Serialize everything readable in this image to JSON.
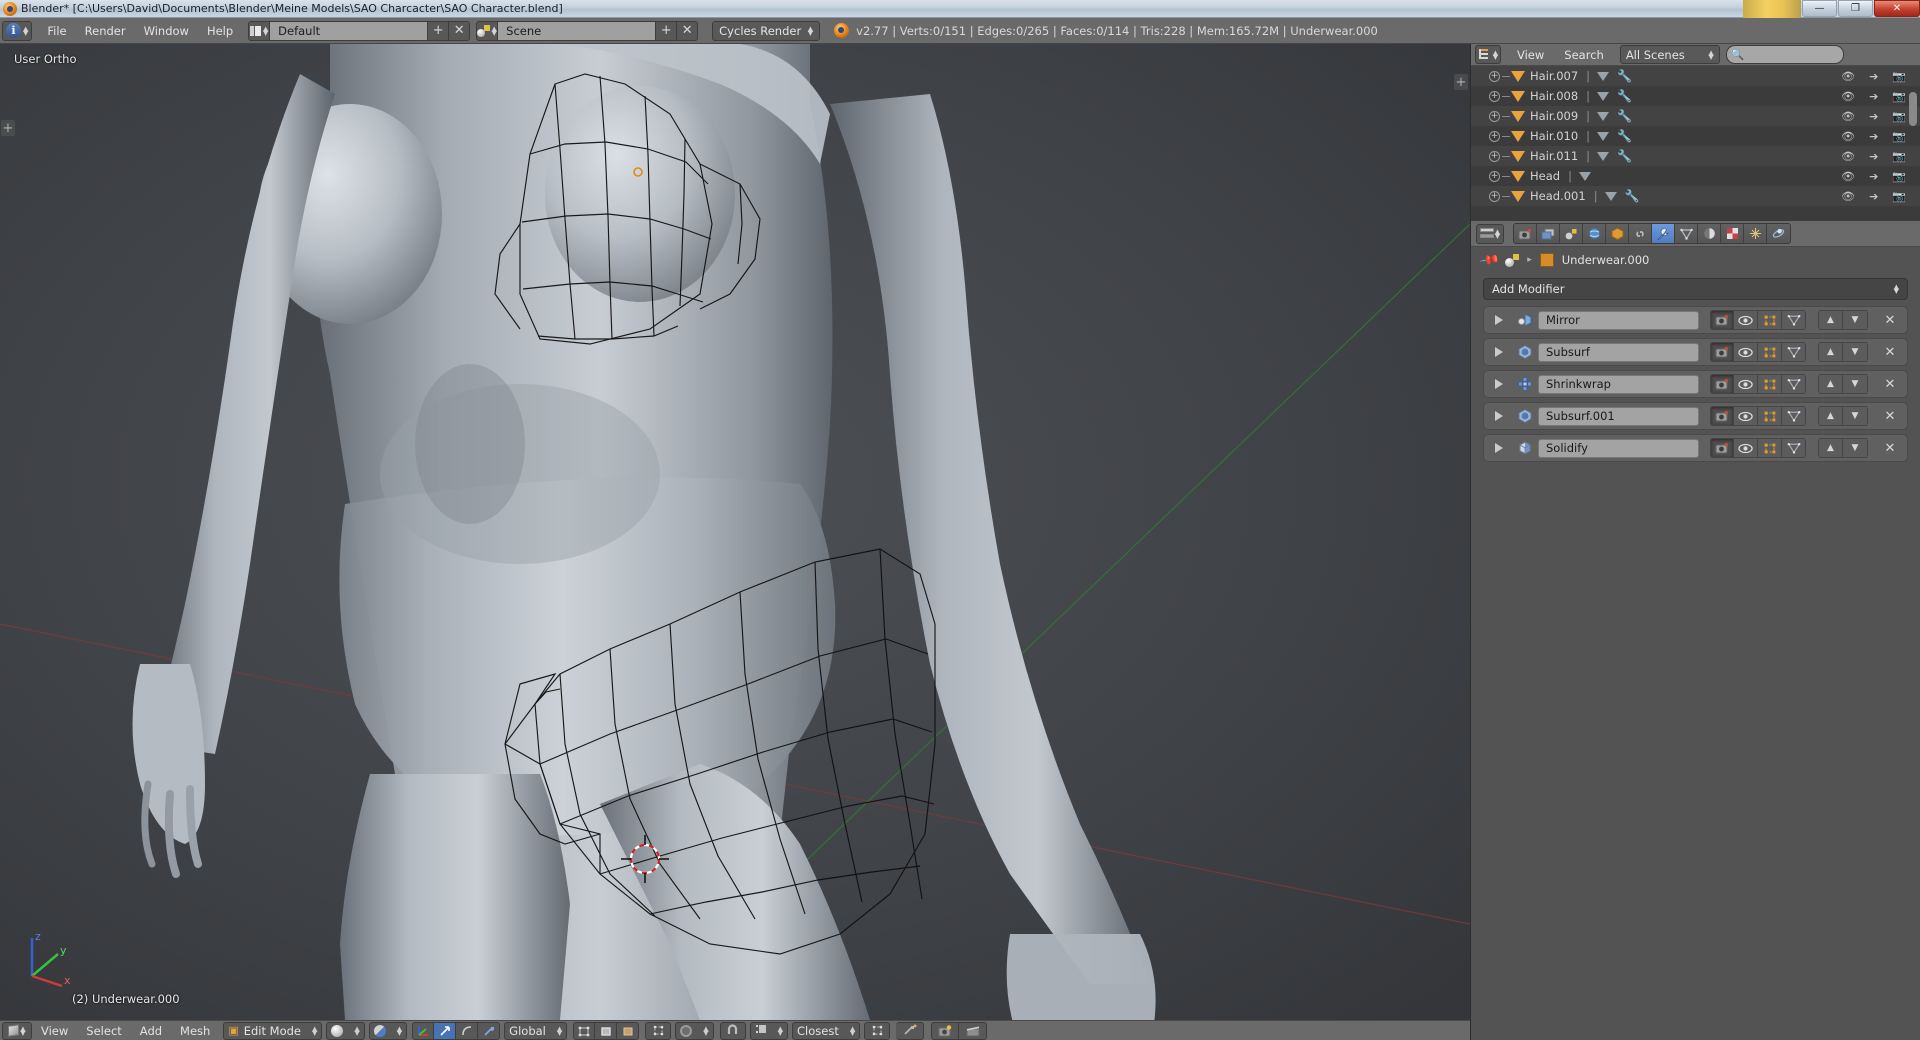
{
  "window": {
    "title": "Blender* [C:\\Users\\David\\Documents\\Blender\\Meine Models\\SAO Charcacter\\SAO Character.blend]",
    "minimize": "—",
    "restore": "❐",
    "close": "✕"
  },
  "topbar": {
    "editor_icon": "info-editor-icon",
    "menus": [
      "File",
      "Render",
      "Window",
      "Help"
    ],
    "screen_layout": "Default",
    "screen_add": "+",
    "screen_delete": "✕",
    "scene_name": "Scene",
    "scene_add": "+",
    "scene_delete": "✕",
    "render_engine": "Cycles Render",
    "stats": "v2.77 | Verts:0/151 | Edges:0/265 | Faces:0/114 | Tris:228 | Mem:165.72M | Underwear.000",
    "stats_parts": {
      "version": "v2.77",
      "verts": "Verts:0/151",
      "edges": "Edges:0/265",
      "faces": "Faces:0/114",
      "tris": "Tris:228",
      "mem": "Mem:165.72M",
      "object": "Underwear.000"
    }
  },
  "viewport": {
    "view_name": "User Ortho",
    "object_label": "(2) Underwear.000",
    "axis_labels": {
      "x": "x",
      "y": "y",
      "z": "z"
    },
    "axis_colors": {
      "x": "#d33a3a",
      "y": "#36c23a",
      "z": "#3a5fd3"
    },
    "plus_left": "+",
    "plus_right": "+",
    "background_color": "#44474b"
  },
  "viewport_footer": {
    "editor_icon": "3d-view-editor-icon",
    "menus": [
      "View",
      "Select",
      "Add",
      "Mesh"
    ],
    "mode": "Edit Mode",
    "viewport_shading": "solid-shading-icon",
    "shading_extra": "material-mode-icon",
    "manipulator_icons": [
      "translate-manipulator-icon",
      "rotate-manipulator-icon",
      "scale-manipulator-icon"
    ],
    "transform_orientation": "Global",
    "select_modes": [
      "vertex-select-icon",
      "edge-select-icon",
      "face-select-icon"
    ],
    "limit_selection": "limit-selection-visible-icon",
    "proportional_edit": "proportional-edit-icon",
    "snap_magnet": "snap-magnet-icon",
    "snap_element": "snap-element-icon",
    "snap_target": "Closest",
    "snap_extra": "snap-onto-self-icon",
    "pivot": "pivot-point-icon",
    "render_buttons": [
      "render-image-icon",
      "render-animation-icon"
    ]
  },
  "outliner": {
    "editor_icon": "outliner-editor-icon",
    "menus": [
      "View",
      "Search"
    ],
    "display_mode": "All Scenes",
    "search_placeholder": "",
    "search_icon": "search-icon",
    "rows": [
      {
        "name": "Hair.007",
        "has_modifier": true
      },
      {
        "name": "Hair.008",
        "has_modifier": true
      },
      {
        "name": "Hair.009",
        "has_modifier": true
      },
      {
        "name": "Hair.010",
        "has_modifier": true
      },
      {
        "name": "Hair.011",
        "has_modifier": true
      },
      {
        "name": "Head",
        "has_modifier": false
      },
      {
        "name": "Head.001",
        "has_modifier": true
      }
    ],
    "row_icons": {
      "eye": "visibility-eye-icon",
      "arrow": "selectable-arrow-icon",
      "camera": "renderable-camera-icon"
    }
  },
  "properties": {
    "editor_icon": "properties-editor-icon",
    "tabs": [
      {
        "name": "render-tab",
        "icon": "camera-back-icon",
        "active": false
      },
      {
        "name": "render-layers-tab",
        "icon": "images-icon",
        "active": false
      },
      {
        "name": "scene-tab",
        "icon": "scene-icon",
        "active": false
      },
      {
        "name": "world-tab",
        "icon": "world-globe-icon",
        "active": false
      },
      {
        "name": "object-tab",
        "icon": "object-cube-icon",
        "active": false
      },
      {
        "name": "constraints-tab",
        "icon": "chain-link-icon",
        "active": false
      },
      {
        "name": "modifiers-tab",
        "icon": "wrench-icon",
        "active": true
      },
      {
        "name": "data-tab",
        "icon": "mesh-data-triangle-icon",
        "active": false
      },
      {
        "name": "material-tab",
        "icon": "material-sphere-icon",
        "active": false
      },
      {
        "name": "texture-tab",
        "icon": "texture-checker-icon",
        "active": false
      },
      {
        "name": "particles-tab",
        "icon": "particles-icon",
        "active": false
      },
      {
        "name": "physics-tab",
        "icon": "physics-orbit-icon",
        "active": false
      }
    ],
    "breadcrumb": {
      "pin_icon": "pin-icon",
      "scene_icon": "scene-icon",
      "separator": "▸",
      "object_icon": "object-cube-icon",
      "object_name": "Underwear.000"
    },
    "add_modifier_label": "Add Modifier",
    "add_modifier_arrows": "⇕",
    "modifiers": [
      {
        "name": "Mirror",
        "icon": "mirror-modifier-icon"
      },
      {
        "name": "Subsurf",
        "icon": "subsurf-modifier-icon"
      },
      {
        "name": "Shrinkwrap",
        "icon": "shrinkwrap-modifier-icon"
      },
      {
        "name": "Subsurf.001",
        "icon": "subsurf-modifier-icon"
      },
      {
        "name": "Solidify",
        "icon": "solidify-modifier-icon"
      }
    ],
    "modifier_toggle_icons": [
      "render-toggle-icon",
      "realtime-eye-toggle-icon",
      "edit-mode-toggle-icon",
      "on-cage-toggle-icon"
    ],
    "modifier_move_up": "▲",
    "modifier_move_down": "▼",
    "modifier_delete": "✕"
  },
  "colors": {
    "header_gray": "#6a6a6a",
    "panel_gray": "#535353",
    "outliner_bg": "#3b3b3b",
    "accent_blue": "#4772b3",
    "mesh_orange": "#e8a33d",
    "viewport_bg": "#44474b"
  }
}
